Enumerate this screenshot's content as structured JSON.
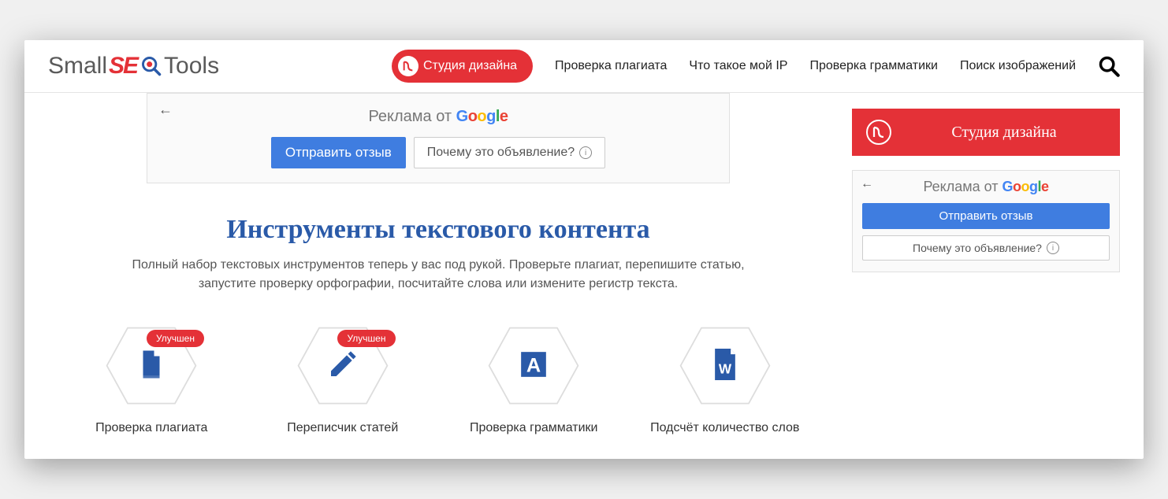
{
  "logo": {
    "part1": "Small",
    "part2": "SE",
    "part3": "Tools"
  },
  "nav": {
    "pill": "Студия дизайна",
    "items": [
      "Проверка плагиата",
      "Что такое мой IP",
      "Проверка грамматики",
      "Поиск изображений"
    ]
  },
  "ad": {
    "prefix": "Реклама от ",
    "feedback": "Отправить отзыв",
    "why": "Почему это объявление?"
  },
  "section": {
    "title": "Инструменты текстового контента",
    "desc": "Полный набор текстовых инструментов теперь у вас под рукой. Проверьте плагиат, перепишите статью, запустите проверку орфографии, посчитайте слова или измените регистр текста."
  },
  "tools": [
    {
      "label": "Проверка плагиата",
      "badge": "Улучшен"
    },
    {
      "label": "Переписчик статей",
      "badge": "Улучшен"
    },
    {
      "label": "Проверка грамматики",
      "badge": null
    },
    {
      "label": "Подсчёт количество слов",
      "badge": null
    }
  ],
  "sidebar": {
    "banner": "Студия дизайна"
  }
}
